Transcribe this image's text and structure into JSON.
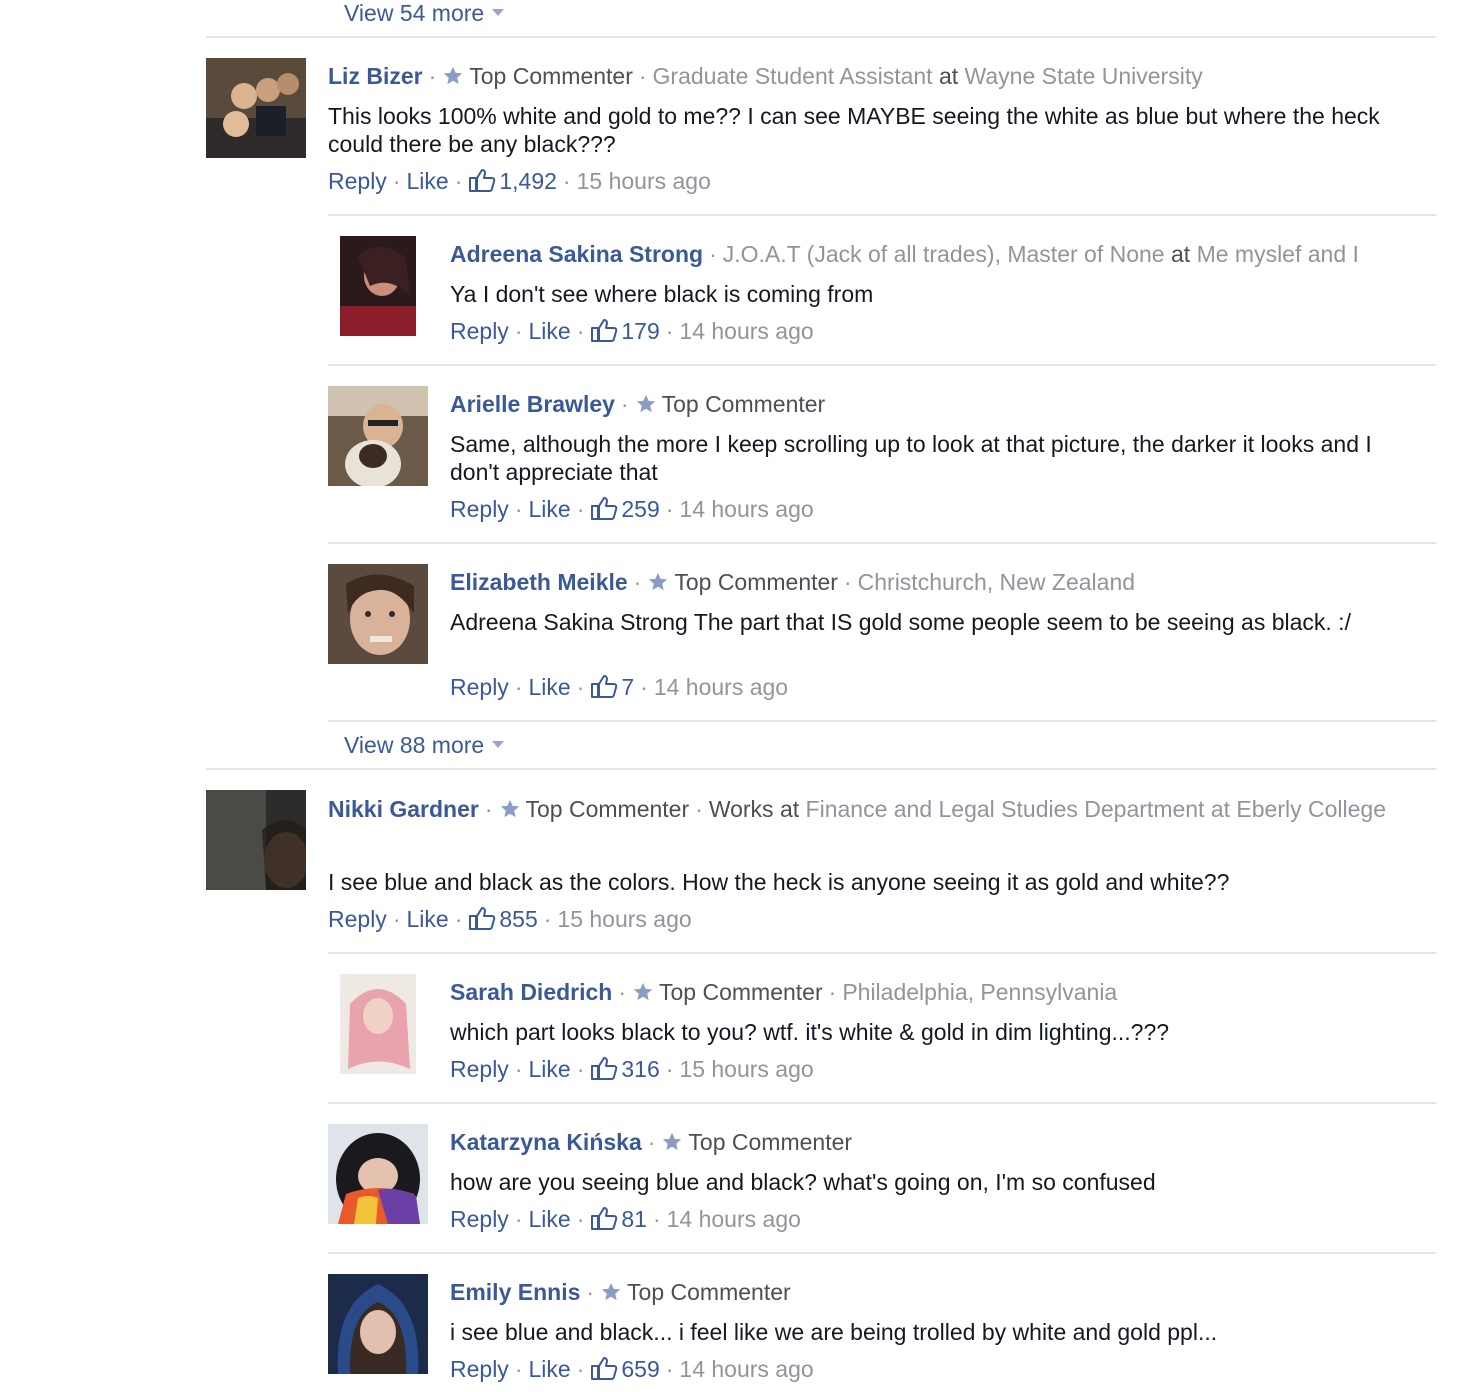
{
  "threads": [
    {
      "view_more_top": "View 54 more",
      "comment": {
        "name": "Liz Bizer",
        "badge": "Top Commenter",
        "work_prefix": "",
        "work_title": "Graduate Student Assistant",
        "work_at": "at",
        "work_place": "Wayne State University",
        "text": "This looks 100% white and gold to me?? I can see MAYBE seeing the white as blue but where the heck could there be any black???",
        "reply": "Reply",
        "like": "Like",
        "likes": "1,492",
        "time": "15 hours ago"
      },
      "replies": [
        {
          "name": "Adreena Sakina Strong",
          "badge": "",
          "work_title": "J.O.A.T (Jack of all trades), Master of None",
          "work_at": "at",
          "work_place": "Me myslef and I",
          "text": "Ya I don't see where black is coming from",
          "reply": "Reply",
          "like": "Like",
          "likes": "179",
          "time": "14 hours ago"
        },
        {
          "name": "Arielle Brawley",
          "badge": "Top Commenter",
          "text": "Same, although the more I keep scrolling up to look at that picture, the darker it looks and I don't appreciate that",
          "reply": "Reply",
          "like": "Like",
          "likes": "259",
          "time": "14 hours ago"
        },
        {
          "name": "Elizabeth Meikle",
          "badge": "Top Commenter",
          "location": "Christchurch, New Zealand",
          "text": "Adreena Sakina Strong The part that IS gold some people seem to be seeing as black. :/",
          "reply": "Reply",
          "like": "Like",
          "likes": "7",
          "time": "14 hours ago"
        }
      ],
      "view_more_bottom": "View 88 more"
    },
    {
      "comment": {
        "name": "Nikki Gardner",
        "badge": "Top Commenter",
        "work_prefix": "Works at",
        "work_place": "Finance and Legal Studies Department at Eberly College",
        "text": "I see blue and black as the colors. How the heck is anyone seeing it as gold and white??",
        "reply": "Reply",
        "like": "Like",
        "likes": "855",
        "time": "15 hours ago"
      },
      "replies": [
        {
          "name": "Sarah Diedrich",
          "badge": "Top Commenter",
          "location": "Philadelphia, Pennsylvania",
          "text": "which part looks black to you? wtf. it's white & gold in dim lighting...???",
          "reply": "Reply",
          "like": "Like",
          "likes": "316",
          "time": "15 hours ago"
        },
        {
          "name": "Katarzyna Kińska",
          "badge": "Top Commenter",
          "text": "how are you seeing blue and black? what's going on, I'm so confused",
          "reply": "Reply",
          "like": "Like",
          "likes": "81",
          "time": "14 hours ago"
        },
        {
          "name": "Emily Ennis",
          "badge": "Top Commenter",
          "text": "i see blue and black... i feel like we are being trolled by white and gold ppl...",
          "reply": "Reply",
          "like": "Like",
          "likes": "659",
          "time": "14 hours ago"
        }
      ]
    }
  ],
  "separator": "·",
  "colors": {
    "link": "#3b5998",
    "muted": "#90949c",
    "divider": "#e5e5e5",
    "text": "#141823"
  },
  "icons": {
    "badge": "star-icon",
    "likes": "thumbs-up-icon",
    "view_more": "caret-down-icon"
  }
}
